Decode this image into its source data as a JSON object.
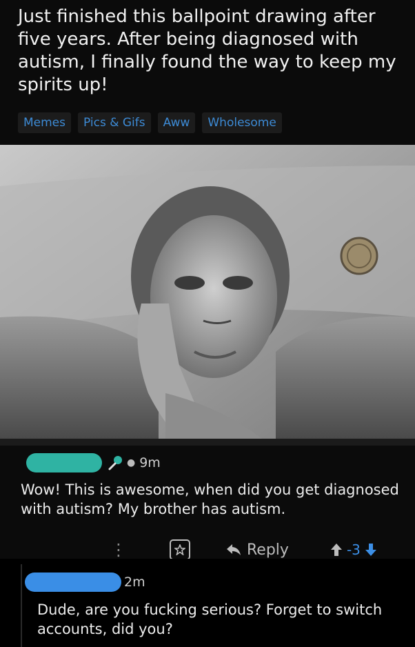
{
  "post": {
    "title": "Just finished this ballpoint drawing after five years. After being diagnosed with autism, I finally found the way to keep my spirits up!",
    "flairs": [
      "Memes",
      "Pics & Gifs",
      "Aww",
      "Wholesome"
    ]
  },
  "comments": [
    {
      "time": "9m",
      "body": "Wow! This is awesome, when did you get diagnosed with autism? My brother has autism.",
      "actions": {
        "reply_label": "Reply",
        "score": "-3"
      }
    },
    {
      "time": "2m",
      "body": "Dude, are you fucking serious? Forget to switch accounts, did you?"
    }
  ],
  "colors": {
    "flair_text": "#3d8bd6",
    "vote_blue": "#3c8fe6",
    "redact_teal": "#2fb3a3",
    "redact_blue": "#3a8ee6"
  },
  "icons": [
    "microphone-icon",
    "more-icon",
    "award-icon",
    "reply-arrow-icon",
    "upvote-icon",
    "downvote-icon"
  ]
}
